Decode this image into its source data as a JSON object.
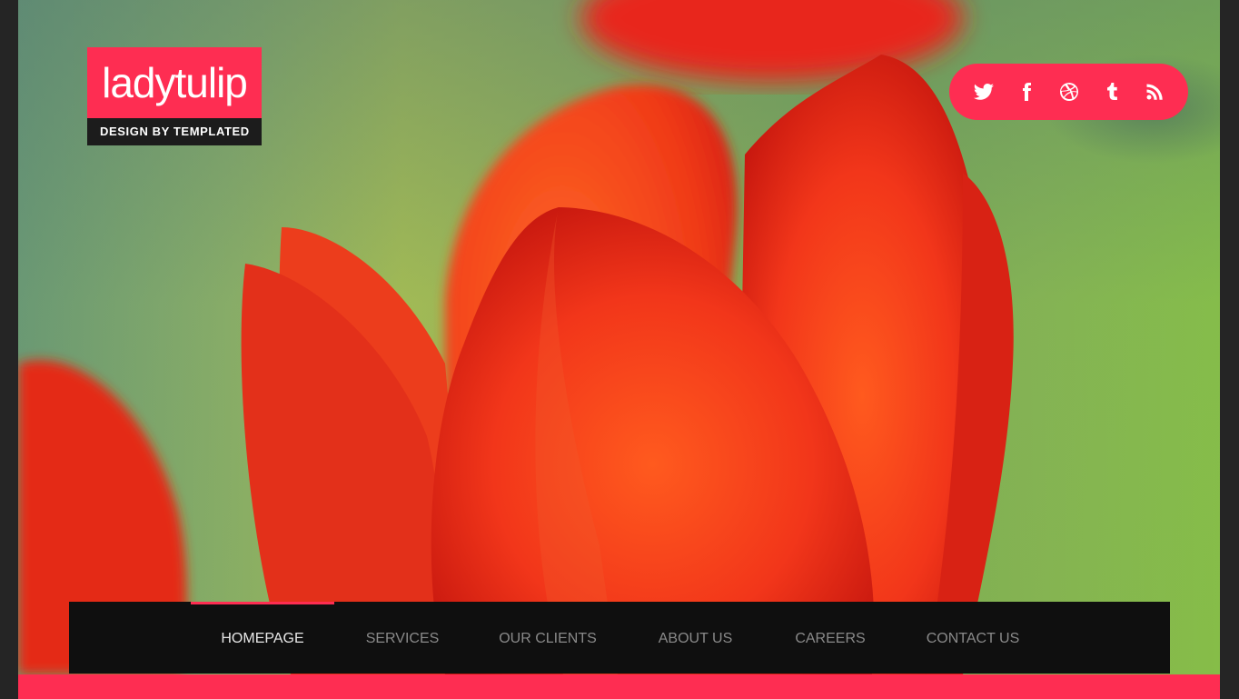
{
  "site": {
    "logo_name": "ladytulip",
    "logo_tagline": "DESIGN BY TEMPLATED"
  },
  "social": [
    {
      "name": "twitter-icon"
    },
    {
      "name": "facebook-icon"
    },
    {
      "name": "dribbble-icon"
    },
    {
      "name": "tumblr-icon"
    },
    {
      "name": "rss-icon"
    }
  ],
  "nav": {
    "items": [
      {
        "label": "HOMEPAGE",
        "active": true
      },
      {
        "label": "SERVICES",
        "active": false
      },
      {
        "label": "OUR CLIENTS",
        "active": false
      },
      {
        "label": "ABOUT US",
        "active": false
      },
      {
        "label": "CAREERS",
        "active": false
      },
      {
        "label": "CONTACT US",
        "active": false
      }
    ]
  },
  "colors": {
    "accent": "#fe2d52",
    "nav_bg": "#0f0f0f",
    "frame": "#252525"
  }
}
